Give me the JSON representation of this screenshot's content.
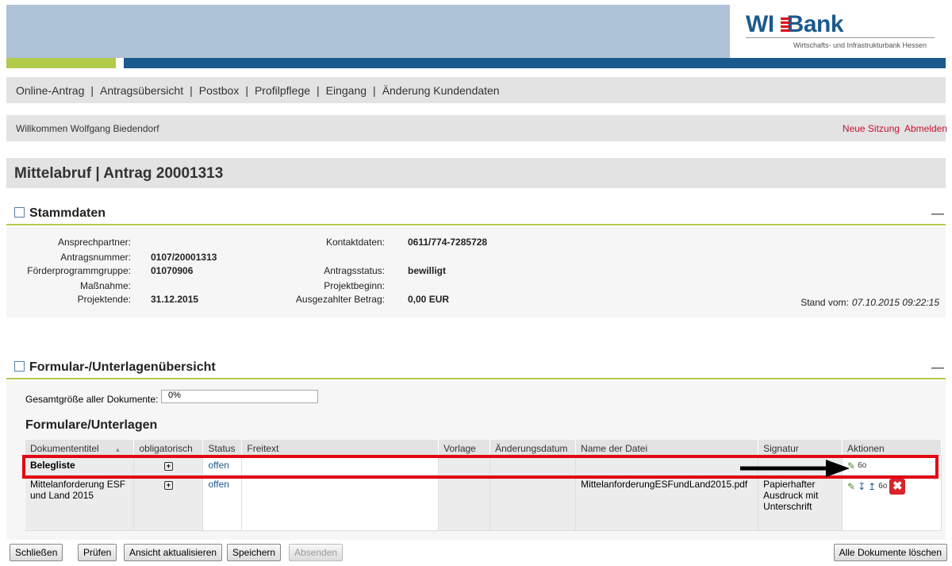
{
  "header": {
    "logo_main": "WI",
    "logo_bank": "Bank",
    "logo_sub": "Wirtschafts- und Infrastrukturbank Hessen"
  },
  "nav": {
    "items": [
      "Online-Antrag",
      "Antragsübersicht",
      "Postbox",
      "Profilpflege",
      "Eingang",
      "Änderung Kundendaten"
    ],
    "separator": "|"
  },
  "welcome": {
    "text": "Willkommen Wolfgang Biedendorf",
    "new_session": "Neue Sitzung",
    "logout": "Abmelden"
  },
  "page": {
    "title": "Mittelabruf | Antrag 20001313"
  },
  "stammdaten": {
    "title": "Stammdaten",
    "collapse": "—",
    "left": [
      {
        "label": "Ansprechpartner:",
        "value": ""
      },
      {
        "label": "Antragsnummer:",
        "value": "0107/20001313"
      },
      {
        "label": "Förderprogrammgruppe:",
        "value": "01070906"
      },
      {
        "label": "Maßnahme:",
        "value": ""
      },
      {
        "label": "Projektende:",
        "value": "31.12.2015"
      }
    ],
    "right": [
      {
        "label": "Kontaktdaten:",
        "value": "0611/774-7285728"
      },
      {
        "label": "Antragsstatus:",
        "value": "bewilligt"
      },
      {
        "label": "Projektbeginn:",
        "value": ""
      },
      {
        "label": "Ausgezahlter Betrag:",
        "value": "0,00 EUR"
      }
    ],
    "stand_label": "Stand vom:",
    "stand_value": "07.10.2015 09:22:15"
  },
  "formulare": {
    "title": "Formular-/Unterlagenübersicht",
    "collapse": "—",
    "size_label": "Gesamtgröße aller Dokumente:",
    "size_value": "0%",
    "subtitle": "Formulare/Unterlagen",
    "columns": [
      "Dokumententitel",
      "obligatorisch",
      "Status",
      "Freitext",
      "Vorlage",
      "Änderungsdatum",
      "Name der Datei",
      "Signatur",
      "Aktionen"
    ],
    "sort_indicator": "▴",
    "rows": [
      {
        "title": "Belegliste",
        "obligatorisch": "+",
        "status": "offen",
        "freitext": "",
        "vorlage": "",
        "datum": "",
        "datei": "",
        "signatur": ""
      },
      {
        "title": "Mittelanforderung ESF und Land 2015",
        "obligatorisch": "+",
        "status": "offen",
        "freitext": "",
        "vorlage": "",
        "datum": "",
        "datei": "MittelanforderungESFundLand2015.pdf",
        "signatur": "Papierhafter Ausdruck mit Unterschrift"
      }
    ]
  },
  "buttons": {
    "close": "Schließen",
    "check": "Prüfen",
    "refresh": "Ansicht aktualisieren",
    "save": "Speichern",
    "send": "Absenden",
    "delete_all": "Alle Dokumente löschen"
  },
  "icons": {
    "edit": "pencil-icon",
    "view": "glasses-icon",
    "upload": "upload-icon",
    "download": "download-icon",
    "delete": "delete-icon"
  },
  "colors": {
    "brand_blue": "#1b5a8d",
    "brand_green": "#b2cb4a",
    "alert_red": "#e30613"
  }
}
